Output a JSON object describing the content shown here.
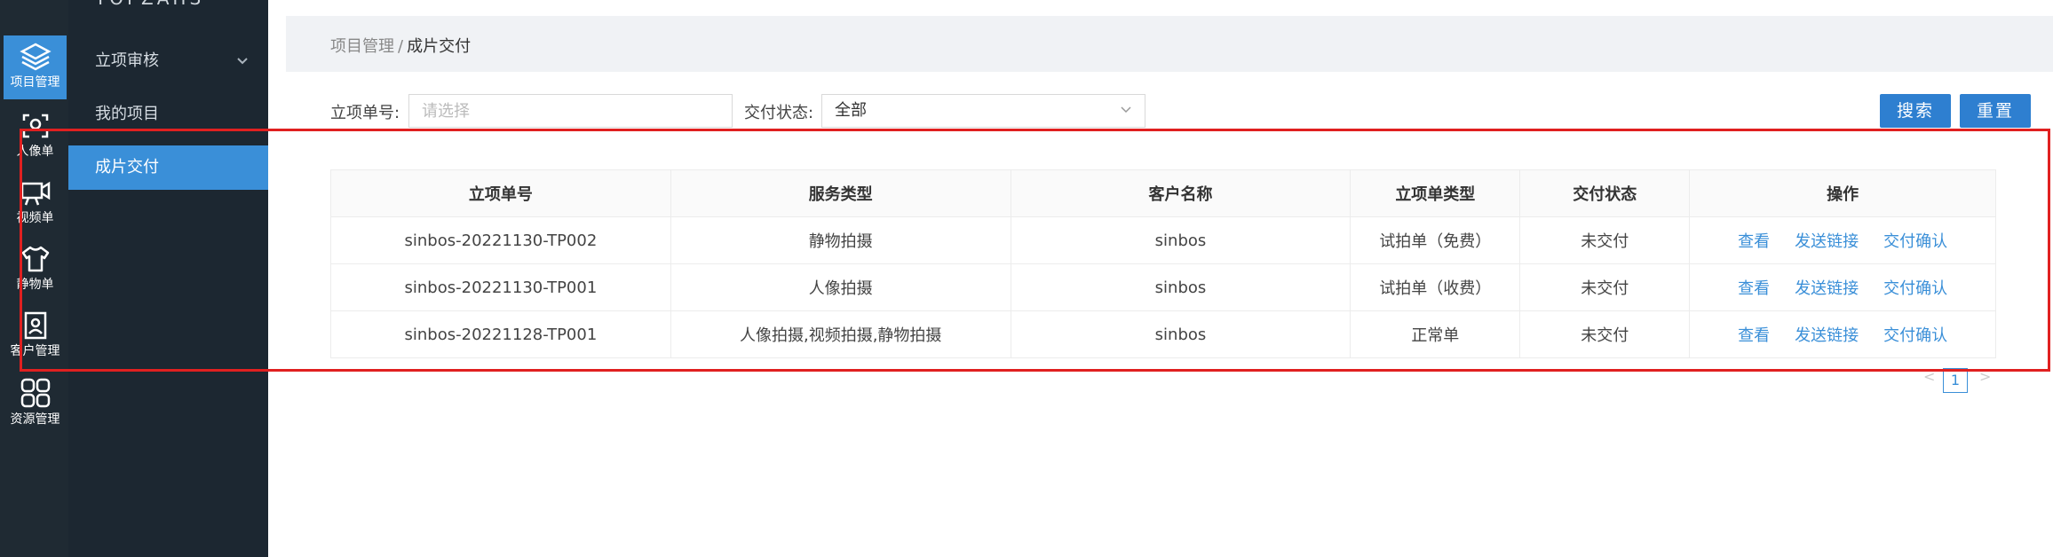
{
  "rail": {
    "items": [
      {
        "label": "项目管理",
        "icon": "layers-icon"
      },
      {
        "label": "人像单",
        "icon": "portrait-scan-icon"
      },
      {
        "label": "视频单",
        "icon": "video-camera-icon"
      },
      {
        "label": "静物单",
        "icon": "tshirt-icon"
      },
      {
        "label": "客户管理",
        "icon": "contact-card-icon"
      },
      {
        "label": "资源管理",
        "icon": "grid-four-icon"
      }
    ],
    "active_color": "#3a8fd8"
  },
  "menu": {
    "logo": "TOPZAHS",
    "items": [
      {
        "label": "立项审核",
        "icon": "chevron-down-icon"
      },
      {
        "label": "我的项目"
      },
      {
        "label": "成片交付"
      }
    ]
  },
  "breadcrumb": {
    "parent": "项目管理",
    "separator": "/",
    "current": "成片交付"
  },
  "filters": {
    "order_label": "立项单号:",
    "order_placeholder": "请选择",
    "status_label": "交付状态:",
    "status_value": "全部"
  },
  "buttons": {
    "search": "搜索",
    "reset": "重置"
  },
  "table": {
    "headers": [
      "立项单号",
      "服务类型",
      "客户名称",
      "立项单类型",
      "交付状态",
      "操作"
    ],
    "rows": [
      {
        "order": "sinbos-20221130-TP002",
        "service": "静物拍摄",
        "client": "sinbos",
        "type": "试拍单（免费）",
        "status": "未交付"
      },
      {
        "order": "sinbos-20221130-TP001",
        "service": "人像拍摄",
        "client": "sinbos",
        "type": "试拍单（收费）",
        "status": "未交付"
      },
      {
        "order": "sinbos-20221128-TP001",
        "service": "人像拍摄,视频拍摄,静物拍摄",
        "client": "sinbos",
        "type": "正常单",
        "status": "未交付"
      }
    ],
    "actions": [
      "查看",
      "发送链接",
      "交付确认"
    ]
  },
  "pagination": {
    "prev": "<",
    "page": "1",
    "next": ">"
  },
  "colors": {
    "primary": "#2e7fd0",
    "sidebar": "#1f2a33",
    "highlight": "#e02020"
  }
}
